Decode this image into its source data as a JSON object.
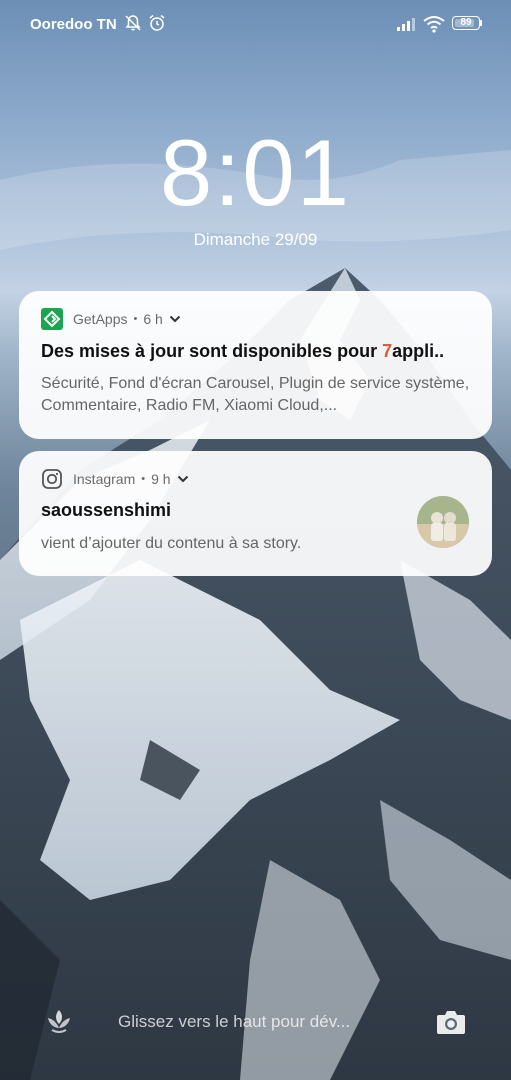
{
  "status_bar": {
    "carrier": "Ooredoo TN",
    "battery": "89",
    "battery_level": 0.89
  },
  "lockscreen": {
    "time": "8:01",
    "date": "Dimanche 29/09"
  },
  "notifications": [
    {
      "app": "GetApps",
      "separator": "•",
      "age": "6 h",
      "title_prefix": "Des mises à jour sont disponibles pour ",
      "title_count": "7",
      "title_suffix": "appli..",
      "body": "Sécurité, Fond d'écran Carousel, Plugin de service système, Commentaire, Radio FM, Xiaomi Cloud,..."
    },
    {
      "app": "Instagram",
      "separator": "•",
      "age": "9 h",
      "title": "saoussenshimi",
      "body": "vient d’ajouter du contenu à sa story."
    }
  ],
  "bottom": {
    "hint": "Glissez vers le haut pour dév..."
  },
  "colors": {
    "highlight": "#e8543c",
    "getapps_green": "#1aa550"
  }
}
